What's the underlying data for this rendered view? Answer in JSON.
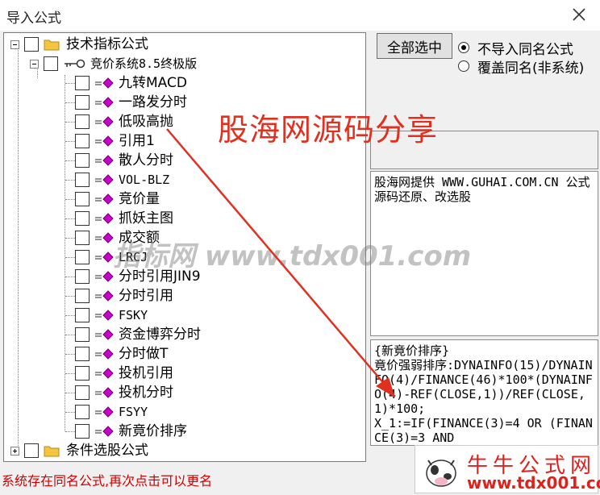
{
  "window": {
    "title": "导入公式"
  },
  "tree": {
    "root": {
      "label": "技术指标公式"
    },
    "group": {
      "label": "竞价系统8.5终极版"
    },
    "items": [
      {
        "label": "九转MACD"
      },
      {
        "label": "一路发分时"
      },
      {
        "label": "低吸高抛"
      },
      {
        "label": "引用1"
      },
      {
        "label": "散人分时"
      },
      {
        "label": "VOL-BLZ"
      },
      {
        "label": "竞价量"
      },
      {
        "label": "抓妖主图"
      },
      {
        "label": "成交额"
      },
      {
        "label": "LRCJ"
      },
      {
        "label": "分时引用JIN9"
      },
      {
        "label": "分时引用"
      },
      {
        "label": "FSKY"
      },
      {
        "label": "资金博弈分时"
      },
      {
        "label": "分时做T"
      },
      {
        "label": "投机引用"
      },
      {
        "label": "投机分时"
      },
      {
        "label": "FSYY"
      },
      {
        "label": "新竟价排序"
      }
    ],
    "root2": {
      "label": "条件选股公式"
    }
  },
  "actions": {
    "select_all": "全部选中"
  },
  "options": {
    "no_import": "不导入同名公式",
    "overwrite": "覆盖同名(非系统)",
    "selected": "no_import"
  },
  "desc": {
    "text": "股海网提供 WWW.GUHAI.COM.CN 公式源码还原、改选股"
  },
  "preview": {
    "text": "{新竟价排序}\n竟价强弱排序:DYNAINFO(15)/DYNAINFO(4)/FINANCE(46)*100*(DYNAINFO(4)-REF(CLOSE,1))/REF(CLOSE,1)*100;\nX_1:=IF(FINANCE(3)=4 OR (FINANCE(3)=3 AND"
  },
  "status": {
    "text": "系统存在同名公式,再次点击可以更名"
  },
  "watermarks": {
    "headline": "股海网源码分享",
    "site": "指标网 www.tdx001.com"
  },
  "logo": {
    "name": "牛牛公式网",
    "url": "www.tdx001.com"
  },
  "colors": {
    "accent_red": "#e0201a",
    "formula_icon": "#cc00cc"
  }
}
